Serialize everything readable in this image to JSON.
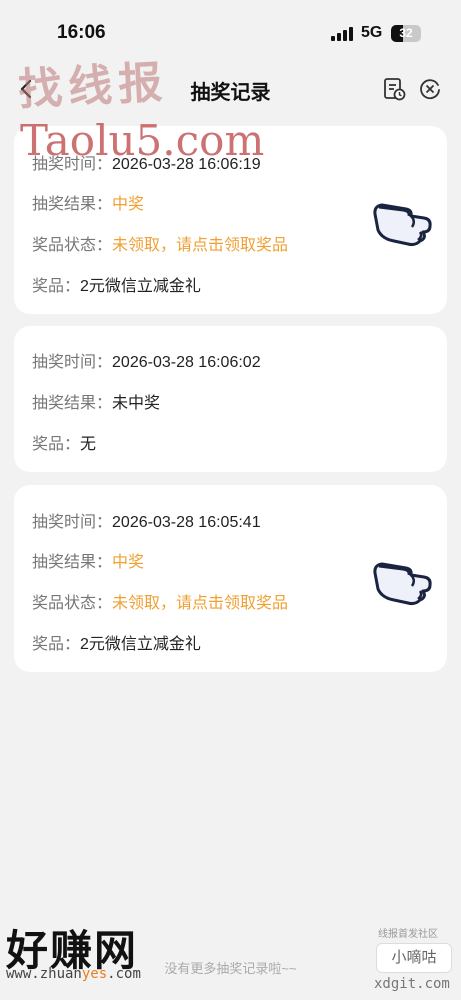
{
  "status_bar": {
    "time": "16:06",
    "network": "5G",
    "battery": "32"
  },
  "nav": {
    "title": "抽奖记录",
    "back_icon": "chevron-left-icon",
    "doc_icon": "document-clock-icon",
    "close_icon": "close-circle-icon"
  },
  "records": [
    {
      "time_label": "抽奖时间：",
      "time": "2026-03-28 16:06:19",
      "result_label": "抽奖结果：",
      "result": "中奖",
      "status_label": "奖品状态：",
      "status": "未领取，请点击领取奖品",
      "prize_label": "奖品：",
      "prize": "2元微信立减金礼",
      "has_action": true
    },
    {
      "time_label": "抽奖时间：",
      "time": "2026-03-28 16:06:02",
      "result_label": "抽奖结果：",
      "result": "未中奖",
      "prize_label": "奖品：",
      "prize": "无",
      "has_action": false
    },
    {
      "time_label": "抽奖时间：",
      "time": "2026-03-28 16:05:41",
      "result_label": "抽奖结果：",
      "result": "中奖",
      "status_label": "奖品状态：",
      "status": "未领取，请点击领取奖品",
      "prize_label": "奖品：",
      "prize": "2元微信立减金礼",
      "has_action": true
    }
  ],
  "footer": {
    "no_more": "没有更多抽奖记录啦~~"
  },
  "watermarks": {
    "top": "找线报",
    "brand": "Taolu5.com",
    "bottom_big": "好赚网",
    "bottom_url_a": "www.zhuan",
    "bottom_url_b": "yes",
    "bottom_url_c": ".com",
    "side_small": "线报首发社区",
    "side_badge": "小嘀咕",
    "side_url": "xdgit.com"
  },
  "colors": {
    "accent": "#f0a033",
    "background": "#f2f2f2",
    "card": "#ffffff",
    "label": "#777777"
  }
}
